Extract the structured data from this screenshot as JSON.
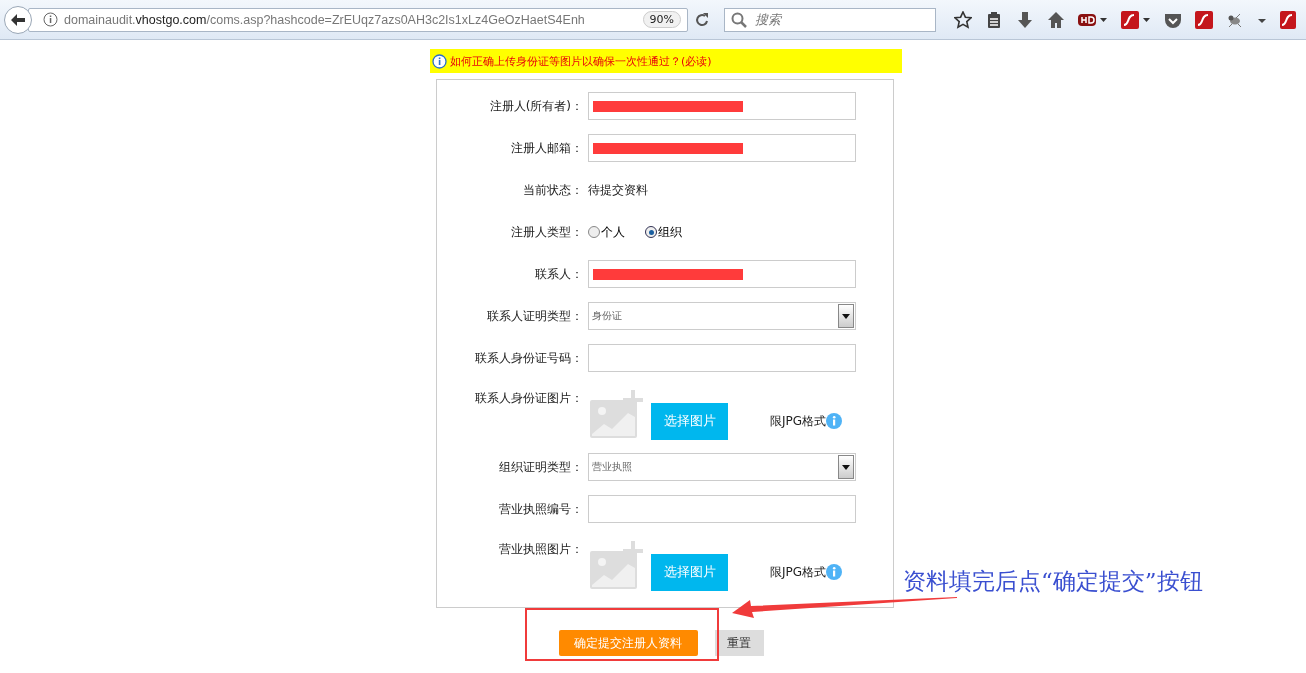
{
  "browser": {
    "url_parts": [
      {
        "text": "domainaudit.",
        "kind": "dim"
      },
      {
        "text": "vhostgo.com",
        "kind": "host"
      },
      {
        "text": "/coms.asp?hashcode=ZrEUqz7azs0AH3c2Is1xLz4GeOzHaetS4Enh",
        "kind": "dim"
      }
    ],
    "zoom": "90%",
    "search_placeholder": "搜索"
  },
  "notice": "如何正确上传身份证等图片以确保一次性通过？(必读)",
  "form_rows": [
    {
      "kind": "input",
      "label": "注册人(所有者)：",
      "redacted": true
    },
    {
      "kind": "input",
      "label": "注册人邮箱：",
      "redacted": true
    },
    {
      "kind": "text",
      "label": "当前状态：",
      "value": "待提交资料"
    },
    {
      "kind": "radio",
      "label": "注册人类型：",
      "options": [
        {
          "label": "个人",
          "selected": false
        },
        {
          "label": "组织",
          "selected": true
        }
      ]
    },
    {
      "kind": "input",
      "label": "联系人：",
      "redacted": true
    },
    {
      "kind": "select",
      "label": "联系人证明类型：",
      "value": "身份证"
    },
    {
      "kind": "input",
      "label": "联系人身份证号码：",
      "redacted": false
    },
    {
      "kind": "upload",
      "label": "联系人身份证图片：",
      "button": "选择图片",
      "hint": "限JPG格式"
    },
    {
      "kind": "select",
      "label": "组织证明类型：",
      "value": "营业执照"
    },
    {
      "kind": "input",
      "label": "营业执照编号：",
      "redacted": false
    },
    {
      "kind": "upload",
      "label": "营业执照图片：",
      "button": "选择图片",
      "hint": "限JPG格式"
    }
  ],
  "actions": {
    "submit": "确定提交注册人资料",
    "reset": "重置"
  },
  "annotation": {
    "text": "资料填完后点“确定提交”按钮"
  }
}
